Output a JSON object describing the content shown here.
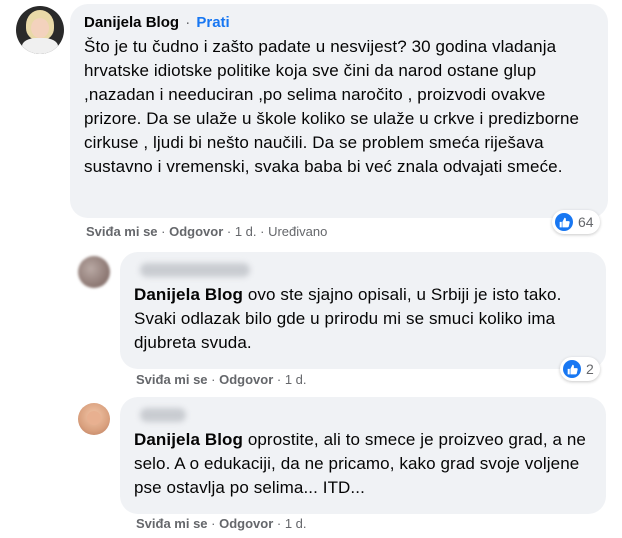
{
  "main_comment": {
    "author": "Danijela Blog",
    "separator": "·",
    "follow_label": "Prati",
    "text": "Što je tu čudno i zašto padate u nesvijest? 30 godina vladanja hrvatske idiotske politike koja sve čini da narod ostane glup ,nazadan i needuciran ,po selima naročito , proizvodi ovakve prizore. Da se ulaže u škole koliko se ulaže u crkve i predizborne cirkuse , ljudi bi nešto naučili. Da se problem smeća riješava sustavno i vremenski, svaka baba bi već znala odvajati smeće.",
    "reaction_count": "64",
    "like_label": "Sviđa mi se",
    "reply_label": "Odgovor",
    "time": "1 d.",
    "edited_label": "Uređivano"
  },
  "replies": [
    {
      "tag": "Danijela Blog",
      "text": " ovo ste sjajno opisali, u Srbiji je isto tako. Svaki odlazak bilo gde u prirodu mi se smuci koliko ima djubreta svuda.",
      "reaction_count": "2",
      "like_label": "Sviđa mi se",
      "reply_label": "Odgovor",
      "time": "1 d."
    },
    {
      "tag": "Danijela Blog",
      "text": " oprostite, ali to smece je proizveo grad, a ne selo. A o edukaciji, da ne pricamo, kako grad svoje voljene pse ostavlja po selima... ITD...",
      "like_label": "Sviđa mi se",
      "reply_label": "Odgovor",
      "time": "1 d."
    }
  ],
  "meta_separator": " · ",
  "colors": {
    "bubble": "#f0f2f5",
    "link_blue": "#1877f2",
    "meta_grey": "#65676b"
  },
  "icons": {
    "reaction": "like-thumb-icon"
  }
}
